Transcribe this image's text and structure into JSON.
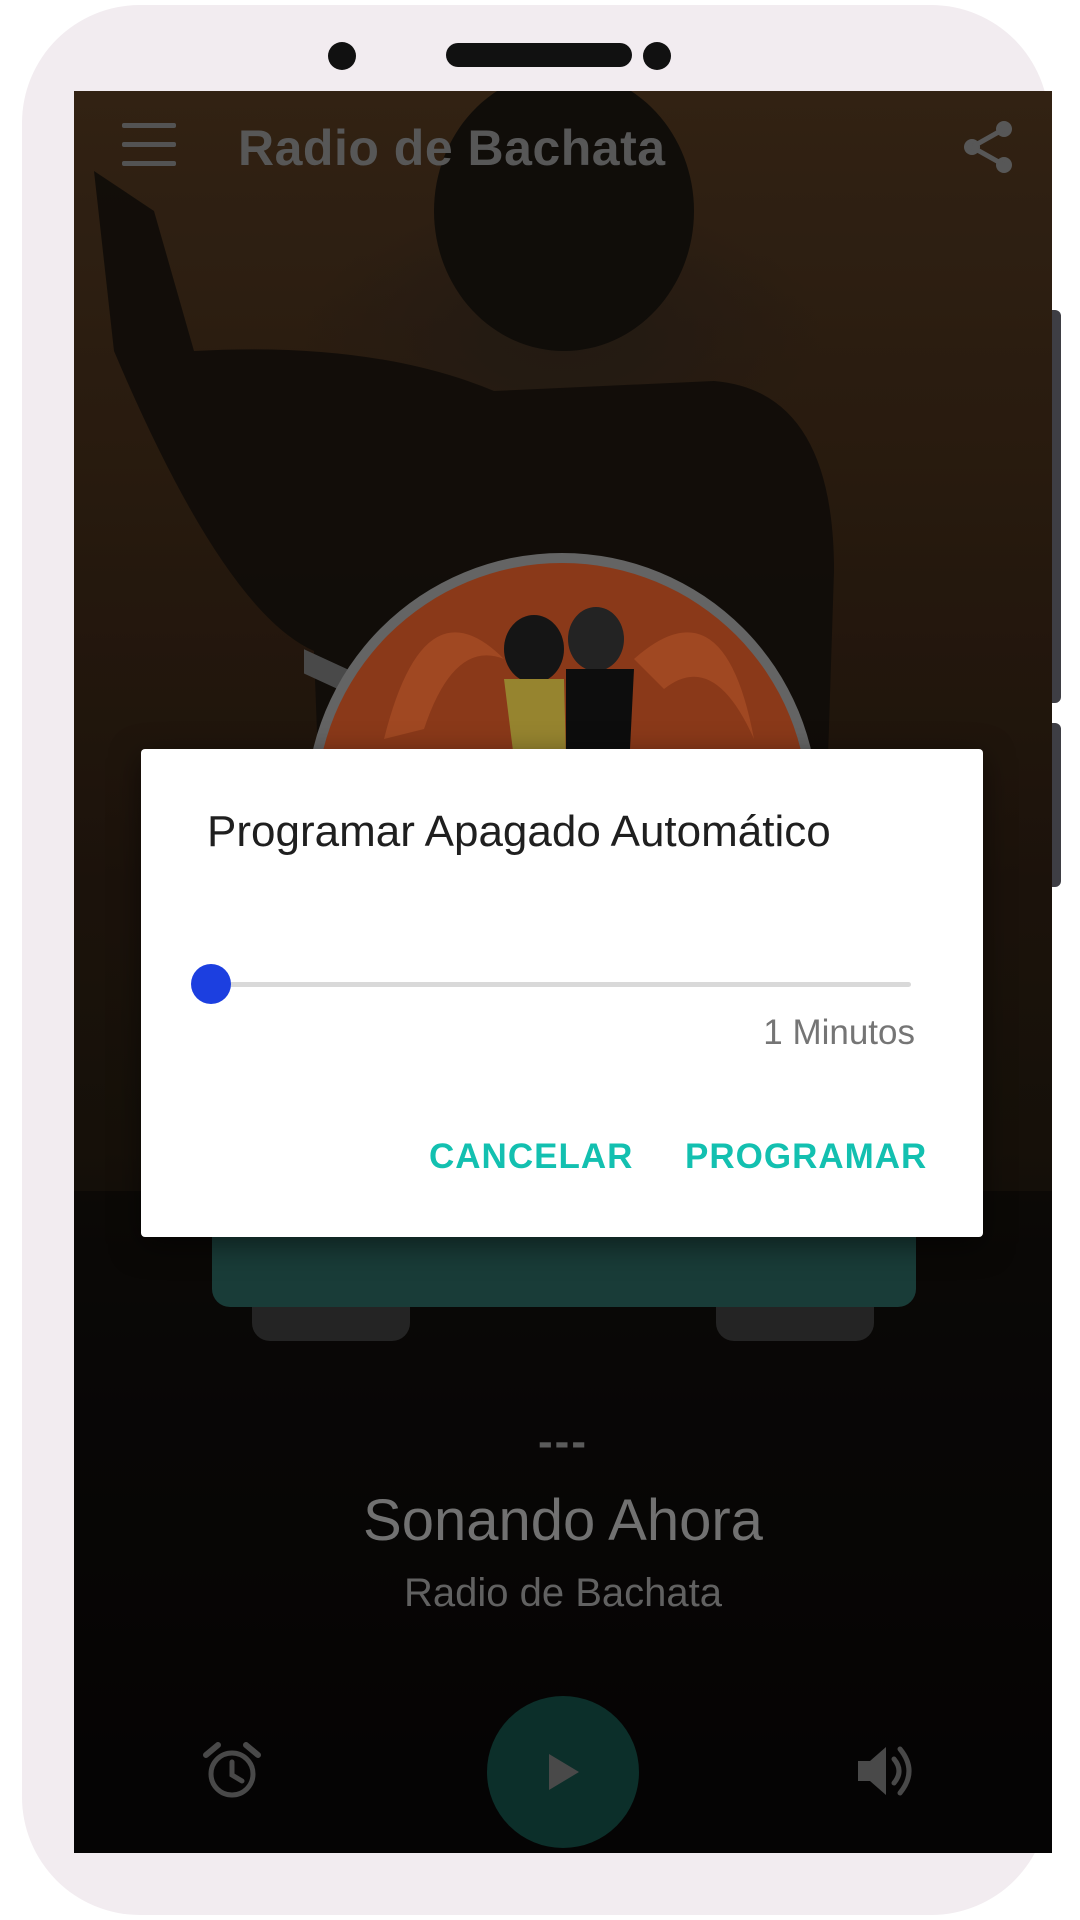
{
  "app": {
    "title": "Radio de Bachata"
  },
  "player": {
    "dashes": "---",
    "now_playing": "Sonando Ahora",
    "station": "Radio de Bachata"
  },
  "dialog": {
    "title": "Programar Apagado Automático",
    "slider_value_label": "1 Minutos",
    "slider_fraction": 0.0,
    "cancel_label": "CANCELAR",
    "confirm_label": "PROGRAMAR"
  },
  "icons": {
    "menu": "menu-icon",
    "share": "share-icon",
    "alarm": "alarm-icon",
    "play": "play-icon",
    "volume": "volume-icon"
  },
  "colors": {
    "accent": "#13c0b0",
    "slider_thumb": "#1c3fe0",
    "play_button": "#0f3a34"
  }
}
